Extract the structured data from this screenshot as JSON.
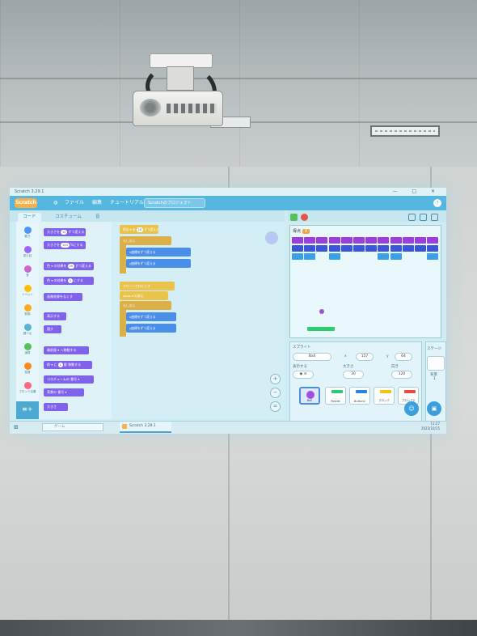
{
  "window": {
    "title": "Scratch 3.29.1",
    "controls": "— □ ✕"
  },
  "menubar": {
    "logo": "Scratch",
    "items": [
      "ファイル",
      "編集",
      "チュートリアル"
    ],
    "project_title": "Scratchのプロジェクト",
    "help": "?"
  },
  "tabs": {
    "code": "コード",
    "costumes": "コスチューム",
    "sounds": "音"
  },
  "categories": [
    {
      "label": "動き",
      "color": "#4c97ff"
    },
    {
      "label": "見た目",
      "color": "#9966ff"
    },
    {
      "label": "音",
      "color": "#cf63cf"
    },
    {
      "label": "イベント",
      "color": "#ffbf00"
    },
    {
      "label": "制御",
      "color": "#ffab19"
    },
    {
      "label": "調べる",
      "color": "#5cb1d6"
    },
    {
      "label": "演算",
      "color": "#59c059"
    },
    {
      "label": "変数",
      "color": "#ff8c1a"
    },
    {
      "label": "ブロック定義",
      "color": "#ff6680"
    }
  ],
  "palette_blocks": [
    {
      "text": "大きさを",
      "value": "10",
      "suffix": "ずつ変える",
      "kind": "looks"
    },
    {
      "text": "大きさを",
      "value": "100",
      "suffix": "%にする",
      "kind": "looks"
    },
    {
      "text": "色 ▾ の効果を",
      "value": "25",
      "suffix": "ずつ変える",
      "kind": "looks"
    },
    {
      "text": "色 ▾ の効果を",
      "value": "0",
      "suffix": "にする",
      "kind": "looks"
    },
    {
      "text": "画像効果をなくす",
      "value": "",
      "suffix": "",
      "kind": "looks"
    },
    {
      "text": "表示する",
      "value": "",
      "suffix": "",
      "kind": "looks"
    },
    {
      "text": "隠す",
      "value": "",
      "suffix": "",
      "kind": "looks"
    },
    {
      "text": "最前面 ▾ へ移動する",
      "value": "",
      "suffix": "",
      "kind": "looks"
    },
    {
      "text": "前 ▾ に",
      "value": "1",
      "suffix": "層 移動する",
      "kind": "looks"
    },
    {
      "text": "コスチュームの 番号 ▾",
      "value": "",
      "suffix": "",
      "kind": "looks"
    },
    {
      "text": "背景の 番号 ▾",
      "value": "",
      "suffix": "",
      "kind": "looks"
    },
    {
      "text": "大きさ",
      "value": "",
      "suffix": "",
      "kind": "looks"
    }
  ],
  "scripts": {
    "group1": [
      {
        "text": "得点 ▾ を",
        "value": "10",
        "suffix": "ずつ変える",
        "kind": "event"
      },
      {
        "text": "もし",
        "value": "",
        "suffix": "なら",
        "kind": "control"
      },
      {
        "text": "x座標を",
        "value": "",
        "suffix": "ずつ変える",
        "kind": "motion"
      },
      {
        "text": "y座標を",
        "value": "",
        "suffix": "ずつ変える",
        "kind": "motion"
      }
    ],
    "group2": [
      {
        "text": "クローンされたとき",
        "value": "",
        "suffix": "",
        "kind": "event"
      },
      {
        "text": "show ▾ の表示",
        "value": "",
        "suffix": "",
        "kind": "event"
      },
      {
        "text": "もし",
        "value": "",
        "suffix": "なら",
        "kind": "control"
      },
      {
        "text": "x座標を",
        "value": "",
        "suffix": "ずつ変える",
        "kind": "motion"
      },
      {
        "text": "y座標を",
        "value": "",
        "suffix": "ずつ変える",
        "kind": "motion"
      }
    ]
  },
  "zoom": {
    "in": "+",
    "out": "−",
    "reset": "="
  },
  "stage": {
    "score_label": "得点",
    "score_value": "0",
    "brick_colors": [
      "#9b3ee0",
      "#3a56d8",
      "#3aa0e8"
    ]
  },
  "sprite_info": {
    "sprite_label": "スプライト",
    "sprite_name": "Ball",
    "x_label": "x",
    "x_value": "157",
    "y_label": "y",
    "y_value": "64",
    "show_label": "表示する",
    "size_label": "大きさ",
    "size_value": "30",
    "direction_label": "向き",
    "direction_value": "120",
    "stage_label": "ステージ",
    "backdrops_label": "背景",
    "backdrops_count": "1"
  },
  "sprites": [
    {
      "name": "Ball",
      "color": "#a04fe0",
      "selected": true
    },
    {
      "name": "Paddle",
      "color": "#2ecc71",
      "selected": false
    },
    {
      "name": "Button2",
      "color": "#2a86e0",
      "selected": false
    },
    {
      "name": "ブロック",
      "color": "#f1c40f",
      "selected": false
    },
    {
      "name": "ブロック2",
      "color": "#e74c3c",
      "selected": false
    }
  ],
  "taskbar": {
    "search_placeholder": "ゲーム",
    "app": "Scratch 3.29.1",
    "time": "11:27",
    "date": "2023/10/15"
  }
}
